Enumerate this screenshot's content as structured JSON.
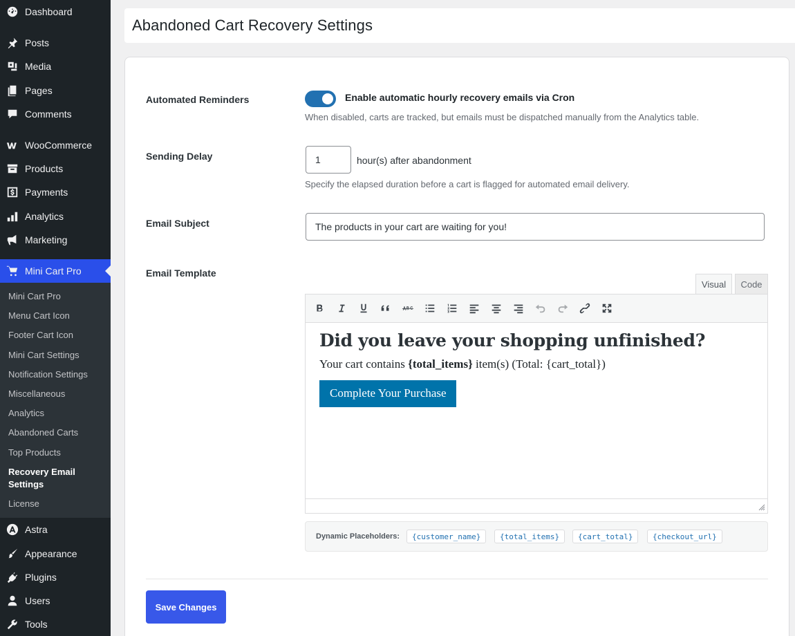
{
  "sidebar": {
    "items": [
      {
        "label": "Dashboard",
        "icon": "dashboard-icon"
      },
      {
        "label": "Posts",
        "icon": "pin-icon"
      },
      {
        "label": "Media",
        "icon": "media-icon"
      },
      {
        "label": "Pages",
        "icon": "pages-icon"
      },
      {
        "label": "Comments",
        "icon": "comment-icon"
      },
      {
        "label": "WooCommerce",
        "icon": "woo-icon"
      },
      {
        "label": "Products",
        "icon": "archive-icon"
      },
      {
        "label": "Payments",
        "icon": "dollar-icon"
      },
      {
        "label": "Analytics",
        "icon": "bar-chart-icon"
      },
      {
        "label": "Marketing",
        "icon": "megaphone-icon"
      },
      {
        "label": "Mini Cart Pro",
        "icon": "cart-icon"
      },
      {
        "label": "Astra",
        "icon": "astra-icon"
      },
      {
        "label": "Appearance",
        "icon": "brush-icon"
      },
      {
        "label": "Plugins",
        "icon": "plug-icon"
      },
      {
        "label": "Users",
        "icon": "user-icon"
      },
      {
        "label": "Tools",
        "icon": "wrench-icon"
      }
    ],
    "submenu": [
      "Mini Cart Pro",
      "Menu Cart Icon",
      "Footer Cart Icon",
      "Mini Cart Settings",
      "Notification Settings",
      "Miscellaneous",
      "Analytics",
      "Abandoned Carts",
      "Top Products",
      "Recovery Email Settings",
      "License"
    ]
  },
  "page": {
    "title": "Abandoned Cart Recovery Settings"
  },
  "settings": {
    "reminders": {
      "label": "Automated Reminders",
      "toggle_label": "Enable automatic hourly recovery emails via Cron",
      "enabled": true,
      "description": "When disabled, carts are tracked, but emails must be dispatched manually from the Analytics table."
    },
    "delay": {
      "label": "Sending Delay",
      "value": "1",
      "suffix": "hour(s) after abandonment",
      "description": "Specify the elapsed duration before a cart is flagged for automated email delivery."
    },
    "subject": {
      "label": "Email Subject",
      "value": "The products in your cart are waiting for you!"
    },
    "template": {
      "label": "Email Template",
      "tab_visual": "Visual",
      "tab_code": "Code",
      "heading": "Did you leave your shopping unfinished?",
      "line_prefix": "Your cart contains ",
      "line_bold": "{total_items}",
      "line_suffix": " item(s) (Total: {cart_total})",
      "button": "Complete Your Purchase"
    },
    "placeholders": {
      "label": "Dynamic Placeholders:",
      "tags": [
        "{customer_name}",
        "{total_items}",
        "{cart_total}",
        "{checkout_url}"
      ]
    }
  },
  "actions": {
    "save_label": "Save Changes"
  },
  "colors": {
    "sidebar_bg": "#1d2327",
    "active_menu": "#2a4fea",
    "toggle_on": "#2271b1",
    "cta": "#0073aa",
    "save": "#3858e9"
  }
}
